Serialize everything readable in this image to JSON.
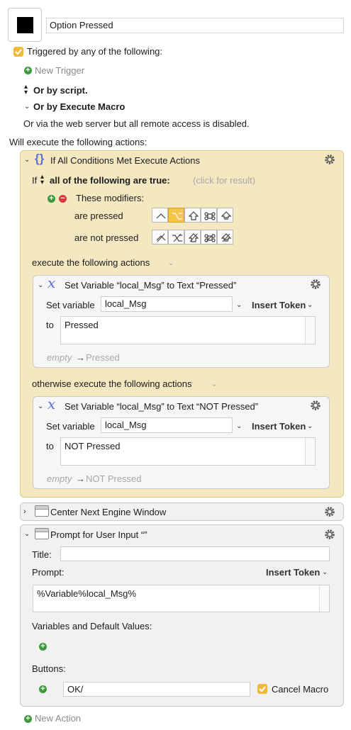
{
  "macro": {
    "name": "Option Pressed"
  },
  "triggers": {
    "checkbox_label": "Triggered by any of the following:",
    "new_trigger": "New Trigger",
    "or_by_script": "Or by script.",
    "or_by_execute_macro": "Or by Execute Macro",
    "web_server_note": "Or via the web server but all remote access is disabled."
  },
  "actions_heading": "Will execute the following actions:",
  "if_action": {
    "title": "If All Conditions Met Execute Actions",
    "if_prefix": "If",
    "condition_mode": "all of the following are true:",
    "click_for_result": "(click for result)",
    "modifiers_label": "These modifiers:",
    "are_pressed": "are pressed",
    "are_not_pressed": "are not pressed",
    "execute_label": "execute the following actions",
    "otherwise_label": "otherwise execute the following actions",
    "pressed_states": [
      false,
      true,
      false,
      false,
      false
    ],
    "not_pressed_states": [
      false,
      false,
      false,
      false,
      false
    ]
  },
  "set_var_1": {
    "title": "Set Variable “local_Msg” to Text “Pressed”",
    "set_variable_label": "Set variable",
    "variable": "local_Msg",
    "insert_token": "Insert Token",
    "to_label": "to",
    "text": "Pressed",
    "preview_empty": "empty",
    "preview_arrow": "→",
    "preview_value": "Pressed"
  },
  "set_var_2": {
    "title": "Set Variable “local_Msg” to Text “NOT Pressed”",
    "set_variable_label": "Set variable",
    "variable": "local_Msg",
    "insert_token": "Insert Token",
    "to_label": "to",
    "text": "NOT Pressed",
    "preview_empty": "empty",
    "preview_arrow": "→",
    "preview_value": "NOT Pressed"
  },
  "center_action": {
    "title": "Center Next Engine Window"
  },
  "prompt_action": {
    "title": "Prompt for User Input “”",
    "title_label": "Title:",
    "title_value": "",
    "prompt_label": "Prompt:",
    "insert_token": "Insert Token",
    "prompt_value": "%Variable%local_Msg%",
    "variables_label": "Variables and Default Values:",
    "buttons_label": "Buttons:",
    "button_value": "OK/",
    "cancel_macro_label": "Cancel Macro"
  },
  "new_action": "New Action",
  "colors": {
    "accent_yellow": "#f5c44b",
    "if_panel_bg": "#f4e8c1",
    "plus_green": "#3c9a3c",
    "minus_red": "#d23c3c",
    "variable_icon_blue": "#5b6fd6"
  }
}
